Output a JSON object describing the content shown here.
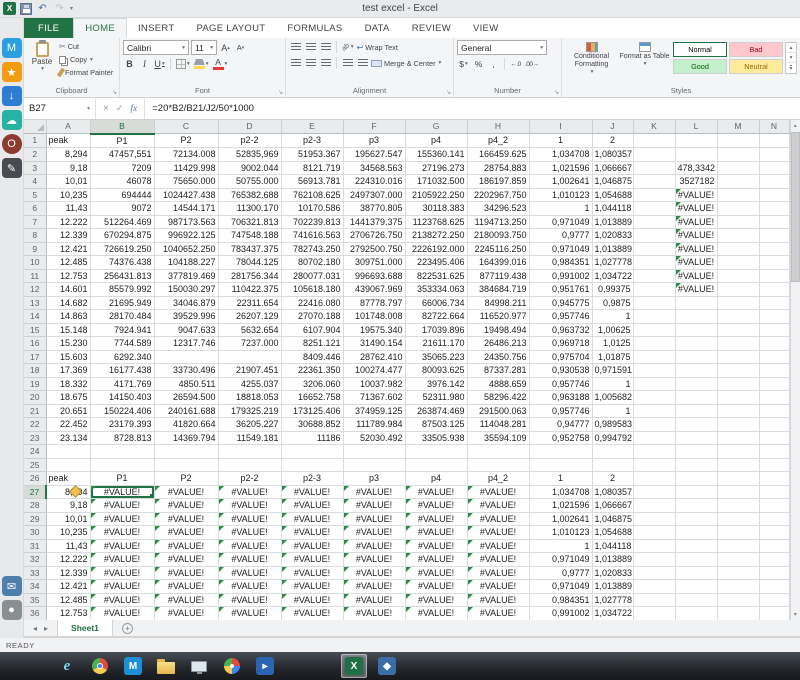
{
  "title_bar": {
    "title": "test excel - Excel"
  },
  "icons": {
    "dropdown": "▾",
    "cancel": "×",
    "enter": "✓",
    "insert_function": "fx"
  },
  "ribbon": {
    "tabs": [
      {
        "label": "FILE",
        "file": true
      },
      {
        "label": "HOME",
        "active": true
      },
      {
        "label": "INSERT"
      },
      {
        "label": "PAGE LAYOUT"
      },
      {
        "label": "FORMULAS"
      },
      {
        "label": "DATA"
      },
      {
        "label": "REVIEW"
      },
      {
        "label": "VIEW"
      }
    ],
    "clipboard": {
      "label": "Clipboard",
      "paste": "Paste",
      "cut": "Cut",
      "copy": "Copy",
      "format_painter": "Format Painter"
    },
    "font": {
      "label": "Font",
      "family": "Calibri",
      "size": "11",
      "bold": "B",
      "italic": "I",
      "underline": "U",
      "grow_letter": "A",
      "shrink_letter": "A",
      "color_letter": "A"
    },
    "alignment": {
      "label": "Alignment",
      "wrap_text": "Wrap Text",
      "merge_center": "Merge & Center"
    },
    "number": {
      "label": "Number",
      "format": "General",
      "currency": "$",
      "percent": "%",
      "comma": ","
    },
    "styles": {
      "label": "Styles",
      "conditional_formatting": "Conditional Formatting",
      "format_as_table": "Format as Table",
      "cell_styles": [
        {
          "name": "Normal",
          "bg": "#ffffff",
          "color": "#000000",
          "selected": true
        },
        {
          "name": "Bad",
          "bg": "#ffc7ce",
          "color": "#9c0006"
        },
        {
          "name": "Good",
          "bg": "#c6efce",
          "color": "#006100"
        },
        {
          "name": "Neutral",
          "bg": "#ffeb9c",
          "color": "#9c6500"
        }
      ]
    }
  },
  "formula_bar": {
    "name_box": "B27",
    "formula": "=20*B2/B21/J2/50*1000"
  },
  "grid": {
    "columns": [
      "A",
      "B",
      "C",
      "D",
      "E",
      "F",
      "G",
      "H",
      "I",
      "J",
      "K",
      "L",
      "M",
      "N"
    ],
    "selected_cell": {
      "col": "B",
      "row": 27
    },
    "accent_color": "#217346",
    "rows": [
      [
        "peak",
        "P1",
        "P2",
        "p2-2",
        "p2-3",
        "p3",
        "p4",
        "p4_2",
        "1",
        "2",
        "",
        "",
        "",
        ""
      ],
      [
        "8,294",
        "47457,551",
        "72134.008",
        "52835,969",
        "51953.367",
        "195627.547",
        "155360.141",
        "166459.625",
        "1,034708",
        "1,080357",
        "",
        "",
        "",
        ""
      ],
      [
        "9,18",
        "7209",
        "11429.998",
        "9002.044",
        "8121.719",
        "34568.563",
        "27196.273",
        "28754.883",
        "1,021596",
        "1,066667",
        "",
        "478,3342",
        "",
        ""
      ],
      [
        "10,01",
        "46078",
        "75650.000",
        "50755.000",
        "56913.781",
        "224310.016",
        "171032.500",
        "186197.859",
        "1,002641",
        "1,046875",
        "",
        "3527182",
        "",
        ""
      ],
      [
        "10,235",
        "694444",
        "1024427.438",
        "765382.688",
        "762108.625",
        "2497307.000",
        "2105922.250",
        "2202967.750",
        "1,010123",
        "1,054688",
        "",
        "#VALUE!",
        "",
        ""
      ],
      [
        "11,43",
        "9072",
        "14544.171",
        "11300.170",
        "10170.586",
        "38770.805",
        "30118.383",
        "34296.523",
        "1",
        "1,044118",
        "",
        "#VALUE!",
        "",
        ""
      ],
      [
        "12.222",
        "512264.469",
        "987173.563",
        "706321.813",
        "702239.813",
        "1441379.375",
        "1123768.625",
        "1194713.250",
        "0,971049",
        "1,013889",
        "",
        "#VALUE!",
        "",
        ""
      ],
      [
        "12.339",
        "670294.875",
        "996922.125",
        "747548.188",
        "741616.563",
        "2706726.750",
        "2138272.250",
        "2180093.750",
        "0,9777",
        "1,020833",
        "",
        "#VALUE!",
        "",
        ""
      ],
      [
        "12.421",
        "726619.250",
        "1040652.250",
        "783437.375",
        "782743.250",
        "2792500.750",
        "2226192.000",
        "2245116.250",
        "0,971049",
        "1,013889",
        "",
        "#VALUE!",
        "",
        ""
      ],
      [
        "12.485",
        "74376.438",
        "104188.227",
        "78044.125",
        "80702.180",
        "309751.000",
        "223495.406",
        "164399.016",
        "0,984351",
        "1,027778",
        "",
        "#VALUE!",
        "",
        ""
      ],
      [
        "12.753",
        "256431.813",
        "377819.469",
        "281756.344",
        "280077.031",
        "996693.688",
        "822531.625",
        "877119.438",
        "0,991002",
        "1,034722",
        "",
        "#VALUE!",
        "",
        ""
      ],
      [
        "14.601",
        "85579.992",
        "150030.297",
        "110422.375",
        "105618.180",
        "439067.969",
        "353334.063",
        "384684.719",
        "0,951761",
        "0,99375",
        "",
        "#VALUE!",
        "",
        ""
      ],
      [
        "14.682",
        "21695.949",
        "34046.879",
        "22311.654",
        "22416.080",
        "87778.797",
        "66006.734",
        "84998.211",
        "0,945775",
        "0,9875",
        "",
        "",
        "",
        ""
      ],
      [
        "14.863",
        "28170.484",
        "39529.996",
        "26207.129",
        "27070.188",
        "101748.008",
        "82722.664",
        "116520.977",
        "0,957746",
        "1",
        "",
        "",
        "",
        ""
      ],
      [
        "15.148",
        "7924.941",
        "9047.633",
        "5632.654",
        "6107.904",
        "19575.340",
        "17039.896",
        "19498.494",
        "0,963732",
        "1,00625",
        "",
        "",
        "",
        ""
      ],
      [
        "15.230",
        "7744.589",
        "12317.746",
        "7237.000",
        "8251.121",
        "31490.154",
        "21611.170",
        "26486.213",
        "0,969718",
        "1,0125",
        "",
        "",
        "",
        ""
      ],
      [
        "15.603",
        "6292.340",
        "",
        "",
        "8409.446",
        "28762.410",
        "35065.223",
        "24350.756",
        "0,975704",
        "1,01875",
        "",
        "",
        "",
        ""
      ],
      [
        "17.369",
        "16177.438",
        "33730.496",
        "21907.451",
        "22361.350",
        "100274.477",
        "80093.625",
        "87337.281",
        "0,930538",
        "0,971591",
        "",
        "",
        "",
        ""
      ],
      [
        "18.332",
        "4171.769",
        "4850.511",
        "4255.037",
        "3206.060",
        "10037.982",
        "3976.142",
        "4888.659",
        "0,957746",
        "1",
        "",
        "",
        "",
        ""
      ],
      [
        "18.675",
        "14150.403",
        "26594.500",
        "18818.053",
        "16652.758",
        "71367.602",
        "52311.980",
        "58296.422",
        "0,963188",
        "1,005682",
        "",
        "",
        "",
        ""
      ],
      [
        "20.651",
        "150224.406",
        "240161.688",
        "179325.219",
        "173125.406",
        "374959.125",
        "263874.469",
        "291500.063",
        "0,957746",
        "1",
        "",
        "",
        "",
        ""
      ],
      [
        "22.452",
        "23179.393",
        "41820.664",
        "36205.227",
        "30688.852",
        "111789.984",
        "87503.125",
        "114048.281",
        "0,94777",
        "0,989583",
        "",
        "",
        "",
        ""
      ],
      [
        "23.134",
        "8728.813",
        "14369.794",
        "11549.181",
        "11186",
        "52030.492",
        "33505.938",
        "35594.109",
        "0,952758",
        "0,994792",
        "",
        "",
        "",
        ""
      ],
      [
        "",
        "",
        "",
        "",
        "",
        "",
        "",
        "",
        "",
        "",
        "",
        "",
        "",
        ""
      ],
      [
        "",
        "",
        "",
        "",
        "",
        "",
        "",
        "",
        "",
        "",
        "",
        "",
        "",
        ""
      ],
      [
        "peak",
        "P1",
        "P2",
        "p2-2",
        "p2-3",
        "p3",
        "p4",
        "p4_2",
        "1",
        "2",
        "",
        "",
        "",
        ""
      ],
      [
        "8,294",
        "#VALUE!",
        "#VALUE!",
        "#VALUE!",
        "#VALUE!",
        "#VALUE!",
        "#VALUE!",
        "#VALUE!",
        "1,034708",
        "1,080357",
        "",
        "",
        "",
        ""
      ],
      [
        "9,18",
        "#VALUE!",
        "#VALUE!",
        "#VALUE!",
        "#VALUE!",
        "#VALUE!",
        "#VALUE!",
        "#VALUE!",
        "1,021596",
        "1,066667",
        "",
        "",
        "",
        ""
      ],
      [
        "10,01",
        "#VALUE!",
        "#VALUE!",
        "#VALUE!",
        "#VALUE!",
        "#VALUE!",
        "#VALUE!",
        "#VALUE!",
        "1,002641",
        "1,046875",
        "",
        "",
        "",
        ""
      ],
      [
        "10,235",
        "#VALUE!",
        "#VALUE!",
        "#VALUE!",
        "#VALUE!",
        "#VALUE!",
        "#VALUE!",
        "#VALUE!",
        "1,010123",
        "1,054688",
        "",
        "",
        "",
        ""
      ],
      [
        "11,43",
        "#VALUE!",
        "#VALUE!",
        "#VALUE!",
        "#VALUE!",
        "#VALUE!",
        "#VALUE!",
        "#VALUE!",
        "1",
        "1,044118",
        "",
        "",
        "",
        ""
      ],
      [
        "12.222",
        "#VALUE!",
        "#VALUE!",
        "#VALUE!",
        "#VALUE!",
        "#VALUE!",
        "#VALUE!",
        "#VALUE!",
        "0,971049",
        "1,013889",
        "",
        "",
        "",
        ""
      ],
      [
        "12.339",
        "#VALUE!",
        "#VALUE!",
        "#VALUE!",
        "#VALUE!",
        "#VALUE!",
        "#VALUE!",
        "#VALUE!",
        "0,9777",
        "1,020833",
        "",
        "",
        "",
        ""
      ],
      [
        "12.421",
        "#VALUE!",
        "#VALUE!",
        "#VALUE!",
        "#VALUE!",
        "#VALUE!",
        "#VALUE!",
        "#VALUE!",
        "0,971049",
        "1,013889",
        "",
        "",
        "",
        ""
      ],
      [
        "12.485",
        "#VALUE!",
        "#VALUE!",
        "#VALUE!",
        "#VALUE!",
        "#VALUE!",
        "#VALUE!",
        "#VALUE!",
        "0,984351",
        "1,027778",
        "",
        "",
        "",
        ""
      ],
      [
        "12.753",
        "#VALUE!",
        "#VALUE!",
        "#VALUE!",
        "#VALUE!",
        "#VALUE!",
        "#VALUE!",
        "#VALUE!",
        "0,991002",
        "1,034722",
        "",
        "",
        "",
        ""
      ]
    ]
  },
  "sheet_bar": {
    "tabs": [
      {
        "label": "Sheet1",
        "active": true
      }
    ]
  },
  "status_bar": {
    "mode": "READY"
  },
  "dock": {
    "top": [
      {
        "name": "m-app",
        "bg": "#2b9fe0",
        "glyph": "M"
      },
      {
        "name": "star-app",
        "bg": "#f39c12",
        "glyph": "★"
      },
      {
        "name": "download-app",
        "bg": "#2d7dd2",
        "glyph": "↓"
      },
      {
        "name": "cloud-app",
        "bg": "#27b3a4",
        "glyph": "☁"
      },
      {
        "name": "browser-app",
        "bg": "#8d3a2f",
        "glyph": "O",
        "round": true
      },
      {
        "name": "notes-app",
        "bg": "#4a4a52",
        "glyph": "✎"
      }
    ],
    "bottom": [
      {
        "name": "mail-app",
        "bg": "#4d7fae",
        "glyph": "✉"
      },
      {
        "name": "settings-app",
        "bg": "#8a8f94",
        "glyph": "●"
      }
    ]
  },
  "taskbar": {
    "icons": [
      {
        "name": "internet-explorer",
        "kind": "ie",
        "glyph": "e"
      },
      {
        "name": "browser-pie",
        "kind": "pie"
      },
      {
        "name": "m-browser",
        "glyph": "M",
        "bg": "#1d8fd7"
      },
      {
        "name": "file-explorer",
        "kind": "folder"
      },
      {
        "name": "network-monitor",
        "kind": "monitor"
      },
      {
        "name": "pinwheel-app",
        "kind": "pie",
        "alt": true
      },
      {
        "name": "media-app",
        "glyph": "▸",
        "bg": "#2a64b2"
      },
      {
        "name": "excel",
        "glyph": "X",
        "bg": "#1f7145",
        "active": true,
        "gap": true
      },
      {
        "name": "blue-app",
        "glyph": "◆",
        "bg": "#3a6ea5"
      }
    ]
  }
}
